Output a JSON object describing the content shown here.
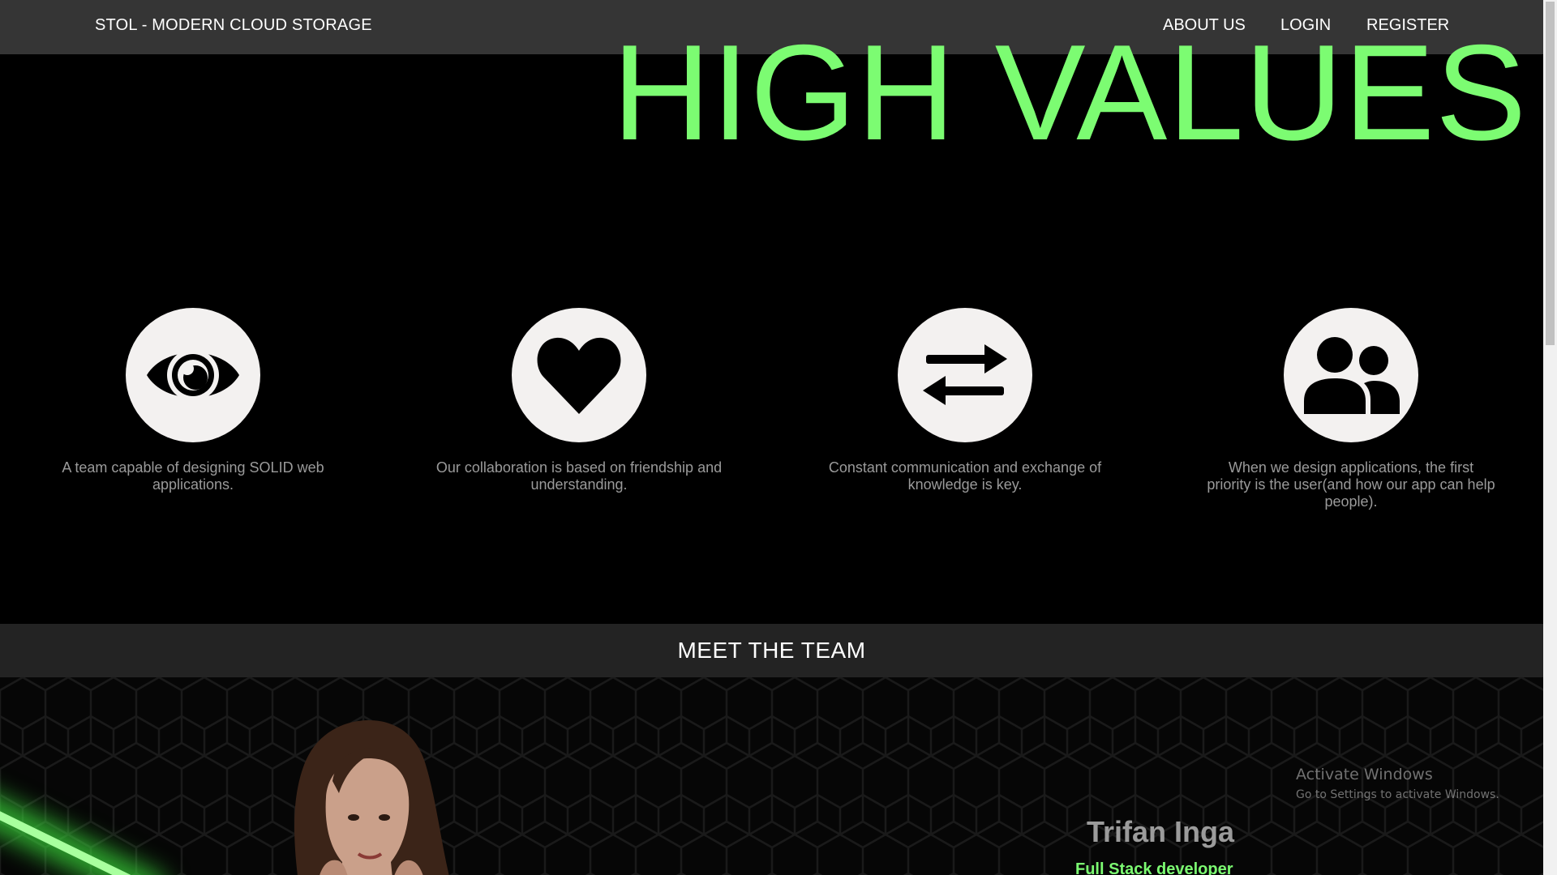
{
  "navbar": {
    "brand": "STOL - MODERN CLOUD STORAGE",
    "links": [
      "ABOUT US",
      "LOGIN",
      "REGISTER"
    ]
  },
  "hero": {
    "title": "HIGH VALUES"
  },
  "values": [
    {
      "icon": "eye-icon",
      "text": "A team capable of designing SOLID web applications."
    },
    {
      "icon": "heart-icon",
      "text": "Our collaboration is based on friendship and understanding."
    },
    {
      "icon": "exchange-arrows-icon",
      "text": "Constant communication and exchange of knowledge is key."
    },
    {
      "icon": "users-icon",
      "text": "When we design applications, the first priority is the user(and how our app can help people)."
    }
  ],
  "team": {
    "heading": "MEET THE TEAM",
    "member": {
      "name": "Trifan Inga",
      "role": "Full Stack developer"
    }
  },
  "watermark": {
    "title": "Activate Windows",
    "subtitle": "Go to Settings to activate Windows."
  },
  "colors": {
    "accent": "#7cfc72",
    "navbar": "#353535",
    "banner": "#232323",
    "icon_circle": "#f3f1f0"
  }
}
